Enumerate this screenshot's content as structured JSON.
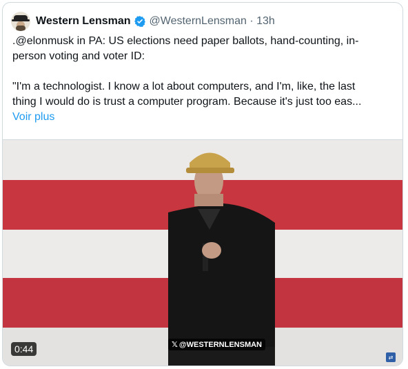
{
  "author": {
    "name": "Western Lensman",
    "handle_time": "@WesternLensman · 13h",
    "verified_color": "#1d9bf0"
  },
  "tweet": {
    "text": ".@elonmusk in PA: US elections need paper ballots, hand-counting, in-\nperson voting and voter ID:\n\n\"I'm a technologist. I know a lot about computers, and I'm, like, the last\nthing I would do is trust a computer program. Because it's just too eas...",
    "more_link": "Voir plus"
  },
  "video": {
    "duration": "0:44",
    "watermark": "@WESTERNLENSMAN",
    "x_logo_icon": "x-logo-icon",
    "badge_icon": "translate-badge-icon"
  }
}
